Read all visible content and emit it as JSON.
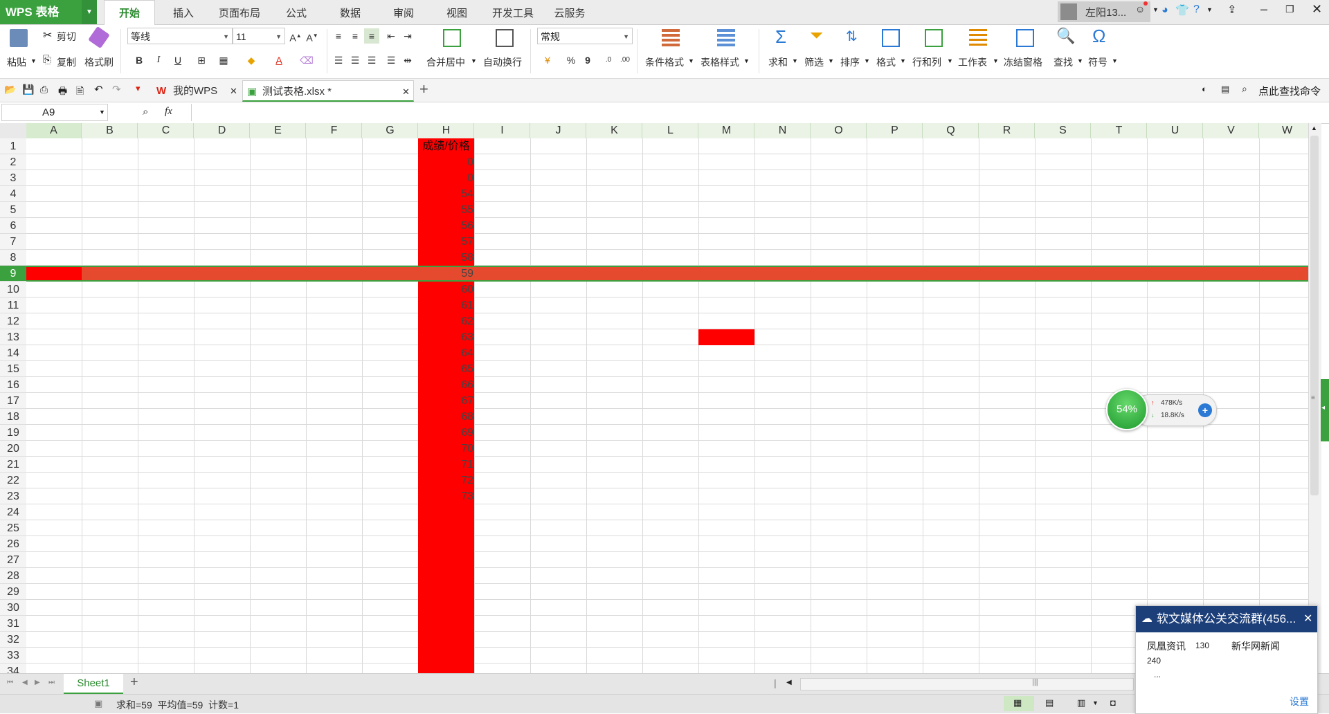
{
  "app": {
    "logo": "WPS 表格"
  },
  "menu": {
    "tabs": [
      "开始",
      "插入",
      "页面布局",
      "公式",
      "数据",
      "审阅",
      "视图",
      "开发工具",
      "云服务"
    ],
    "active_index": 0,
    "user_name": "左阳13..."
  },
  "ribbon": {
    "paste": "粘贴",
    "cut": "剪切",
    "copy": "复制",
    "format_painter": "格式刷",
    "font_name": "等线",
    "font_size": "11",
    "bold": "B",
    "italic": "I",
    "underline": "U",
    "merge_center": "合并居中",
    "wrap_text": "自动换行",
    "number_format": "常规",
    "percent": "%",
    "comma": "9",
    "conditional_format": "条件格式",
    "table_style": "表格样式",
    "sum": "求和",
    "filter": "筛选",
    "sort": "排序",
    "format": "格式",
    "row_col": "行和列",
    "worksheet": "工作表",
    "freeze": "冻结窗格",
    "find": "查找",
    "symbol": "符号"
  },
  "doc_tabs": {
    "home_tab": "我的WPS",
    "file_tab": "测试表格.xlsx *",
    "search_cmd": "点此查找命令"
  },
  "formula_bar": {
    "cell_ref": "A9",
    "fx": "fx",
    "value": ""
  },
  "grid": {
    "columns": [
      "A",
      "B",
      "C",
      "D",
      "E",
      "F",
      "G",
      "H",
      "I",
      "J",
      "K",
      "L",
      "M",
      "N",
      "O",
      "P",
      "Q",
      "R",
      "S",
      "T",
      "U",
      "V",
      "W"
    ],
    "rows": [
      "1",
      "2",
      "3",
      "4",
      "5",
      "6",
      "7",
      "8",
      "9",
      "10",
      "11",
      "12",
      "13",
      "14",
      "15",
      "16",
      "17",
      "18",
      "19",
      "20",
      "21",
      "22",
      "23",
      "24",
      "25",
      "26",
      "27",
      "28",
      "29",
      "30",
      "31",
      "32",
      "33",
      "34"
    ],
    "selected_row": "9",
    "selected_column": "A",
    "h_column_values": [
      "成绩/价格",
      "0",
      "0",
      "54",
      "55",
      "56",
      "57",
      "58",
      "59",
      "60",
      "61",
      "62",
      "63",
      "64",
      "65",
      "66",
      "67",
      "68",
      "69",
      "70",
      "71",
      "72",
      "73"
    ],
    "colors": {
      "highlight_red": "#ff0000",
      "row_highlight": "#e64a2e",
      "accent_green": "#3aa13e"
    }
  },
  "sheet_tabs": {
    "active": "Sheet1",
    "add": "+"
  },
  "status": {
    "text": "求和=59  平均值=59  计数=1"
  },
  "speed_widget": {
    "percent": "54%",
    "up": "478K/s",
    "down": "18.8K/s"
  },
  "popup": {
    "title": "软文媒体公关交流群(456...",
    "line1_a": "凤凰资讯",
    "line1_b": "130",
    "line1_c": "新华网新闻",
    "line2": "240",
    "line3": "...",
    "settings": "设置"
  }
}
